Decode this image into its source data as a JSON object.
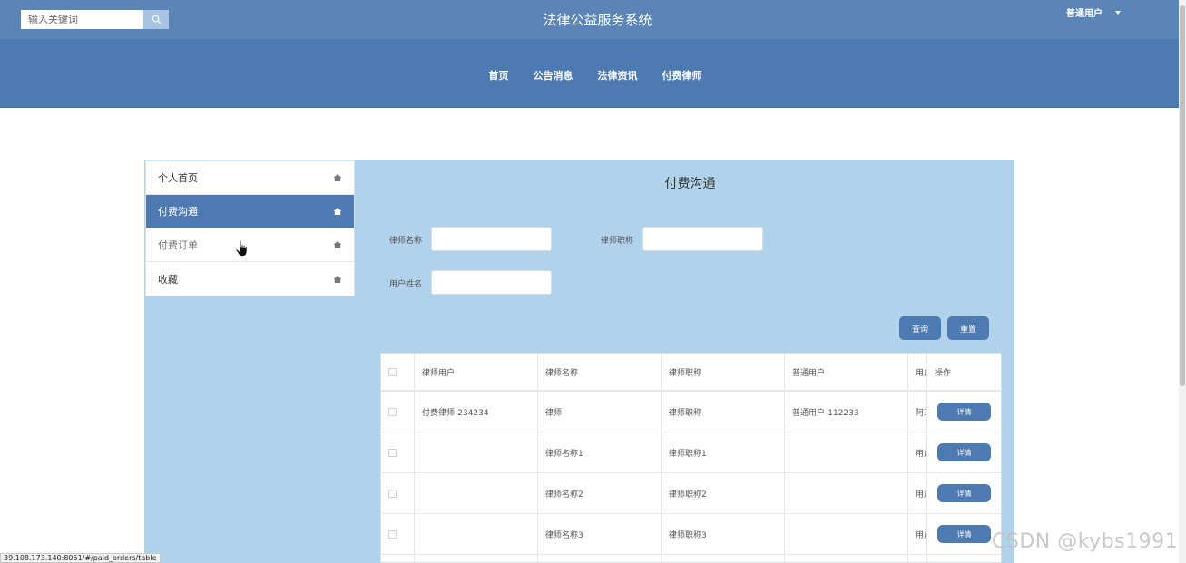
{
  "header": {
    "search_placeholder": "输入关键词",
    "site_title": "法律公益服务系统",
    "user_label": "普通用户"
  },
  "nav": {
    "items": [
      "首页",
      "公告消息",
      "法律资讯",
      "付费律师"
    ]
  },
  "sidebar": {
    "items": [
      {
        "label": "个人首页",
        "state": "normal"
      },
      {
        "label": "付费沟通",
        "state": "active"
      },
      {
        "label": "付费订单",
        "state": "hover"
      },
      {
        "label": "收藏",
        "state": "normal"
      }
    ]
  },
  "main": {
    "title": "付费沟通",
    "filters": {
      "lawyer_name_label": "律师名称",
      "lawyer_title_label": "律师职称",
      "user_name_label": "用户姓名"
    },
    "buttons": {
      "query": "查询",
      "reset": "重置"
    },
    "table": {
      "headers": [
        "律师用户",
        "律师名称",
        "律师职称",
        "普通用户",
        "用户",
        "操作"
      ],
      "rows": [
        {
          "lawyer_user": "付费律师-234234",
          "lawyer_name": "律师",
          "lawyer_title": "律师职称",
          "user": "普通用户-112233",
          "user_name": "阿五",
          "action": "详情"
        },
        {
          "lawyer_user": "",
          "lawyer_name": "律师名称1",
          "lawyer_title": "律师职称1",
          "user": "",
          "user_name": "用户",
          "action": "详情"
        },
        {
          "lawyer_user": "",
          "lawyer_name": "律师名称2",
          "lawyer_title": "律师职称2",
          "user": "",
          "user_name": "用户",
          "action": "详情"
        },
        {
          "lawyer_user": "",
          "lawyer_name": "律师名称3",
          "lawyer_title": "律师职称3",
          "user": "",
          "user_name": "用户",
          "action": "详情"
        }
      ]
    }
  },
  "status_bar": {
    "url": "39.108.173.140:8051/#/paid_orders/table"
  },
  "watermark": "CSDN @kybs1991",
  "colors": {
    "topbar": "#5b84b7",
    "navbar": "#4d7ab0",
    "panel": "#b0d3eb",
    "accent": "#4d7ab0"
  },
  "icons": {
    "search": "search-icon",
    "sidebar_item": "home-icon",
    "caret": "caret-down-icon"
  }
}
